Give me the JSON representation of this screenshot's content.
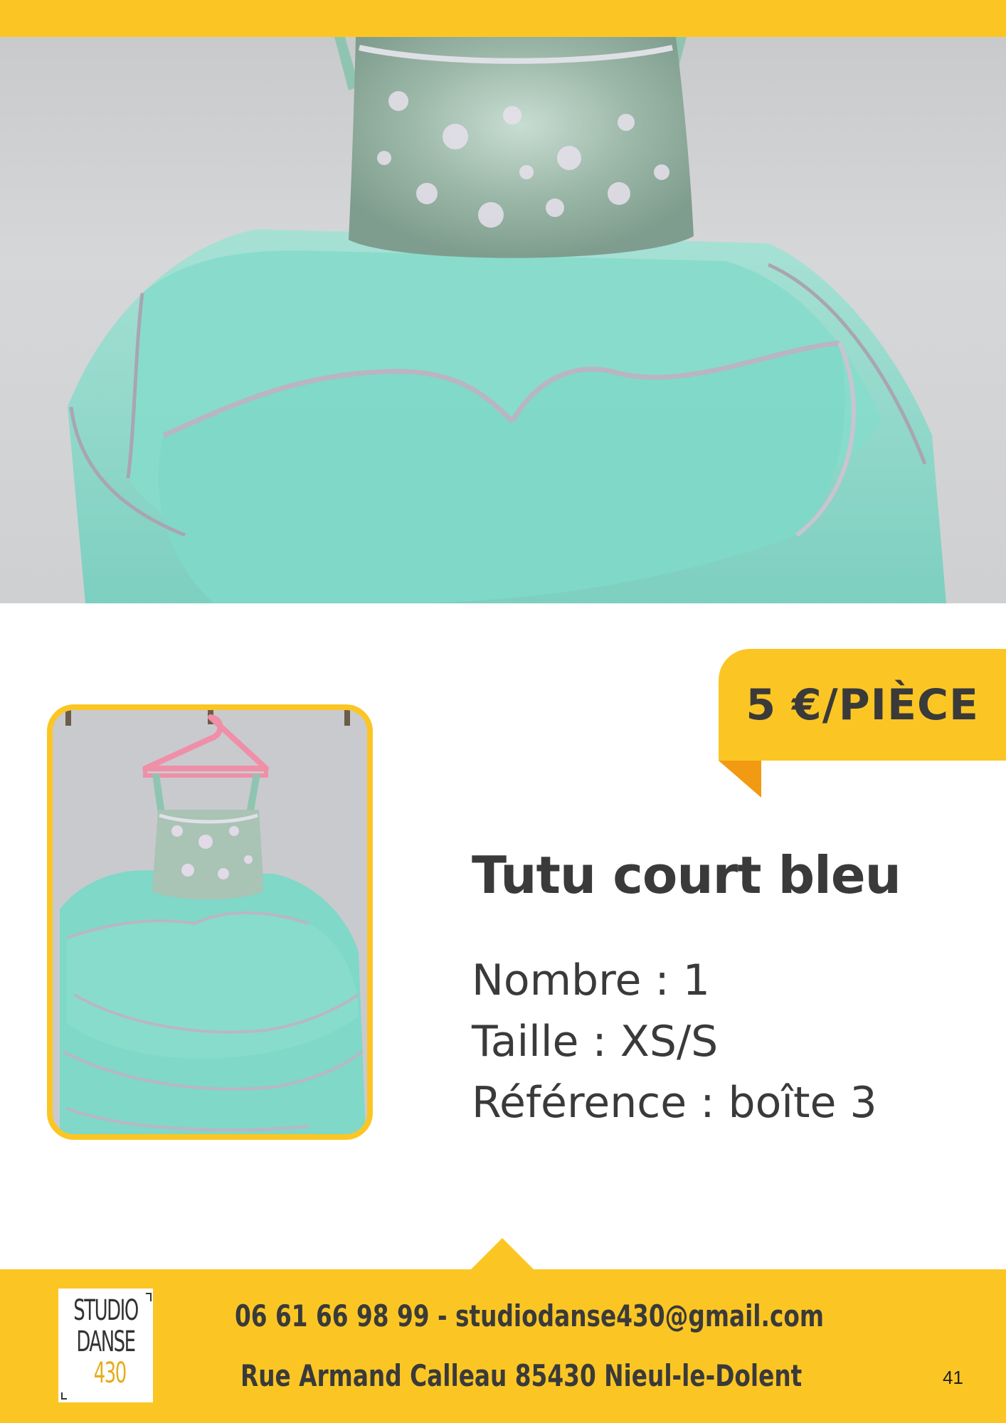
{
  "price": {
    "label": "5 €/PIÈCE"
  },
  "product": {
    "title": "Tutu court bleu",
    "specs": [
      "Nombre : 1",
      "Taille : XS/S",
      "Référence : boîte 3"
    ]
  },
  "footer": {
    "logo": {
      "line1": "STUDIO",
      "line2": "DANSE",
      "line3": "430"
    },
    "contact_line": "06 61 66 98 99 - studiodanse430@gmail.com",
    "address_line": "Rue Armand Calleau 85430 Nieul-le-Dolent",
    "page_number": "41"
  },
  "colors": {
    "accent_yellow": "#fbc624",
    "accent_orange": "#f29a12",
    "text_dark": "#3a3a3a",
    "tulle_turquoise": "#7fd8c8"
  },
  "icons": {
    "hero": "tutu-photo-icon",
    "thumb": "tutu-hanger-photo-icon"
  }
}
